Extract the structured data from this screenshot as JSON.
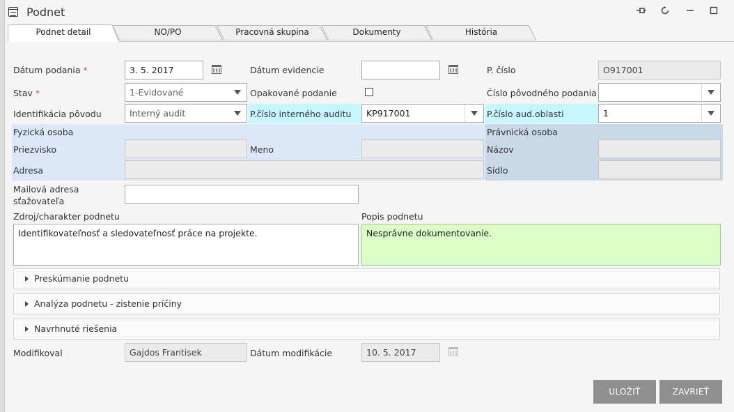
{
  "window": {
    "title": "Podnet"
  },
  "tabs": [
    "Podnet detail",
    "NO/PO",
    "Pracovná skupina",
    "Dokumenty",
    "História"
  ],
  "form": {
    "datum_podania": {
      "label": "Dátum podania",
      "required": "*",
      "value": "3. 5. 2017"
    },
    "datum_evidencie": {
      "label": "Dátum evidencie",
      "value": ""
    },
    "p_cislo": {
      "label": "P. číslo",
      "value": "O917001"
    },
    "stav": {
      "label": "Stav",
      "required": "*",
      "value": "1-Evidované"
    },
    "opakovane_podanie": {
      "label": "Opakované podanie",
      "checked": false
    },
    "cislo_povodneho": {
      "label": "Číslo pôvodného podania",
      "value": ""
    },
    "identifikacia_povodu": {
      "label": "Identifikácia pôvodu",
      "value": "Interný audit"
    },
    "p_cislo_auditu": {
      "label": "P.číslo interného auditu",
      "value": "KP917001"
    },
    "p_cislo_oblasti": {
      "label": "P.číslo aud.oblasti",
      "value": "1"
    },
    "fyzicka_osoba": {
      "label": "Fyzická osoba"
    },
    "priezvisko": {
      "label": "Priezvisko",
      "value": ""
    },
    "meno": {
      "label": "Meno",
      "value": ""
    },
    "adresa": {
      "label": "Adresa",
      "value": ""
    },
    "pravnicka_osoba": {
      "label": "Právnická osoba"
    },
    "nazov": {
      "label": "Názov",
      "value": ""
    },
    "sidlo": {
      "label": "Sídlo",
      "value": ""
    },
    "mailova_adresa": {
      "label_line1": "Mailová adresa",
      "label_line2": "sťažovateľa",
      "value": ""
    },
    "zdroj": {
      "label": "Zdroj/charakter podnetu",
      "value": "Identifikovateľnosť a sledovateľnosť práce na projekte."
    },
    "popis": {
      "label": "Popis podnetu",
      "value": "Nesprávne dokumentovanie."
    }
  },
  "sections": [
    "Preskúmanie podnetu",
    "Analýza podnetu - zistenie príčiny",
    "Navrhnuté riešenia"
  ],
  "footer": {
    "modifikoval": {
      "label": "Modifikoval",
      "value": "Gajdos Frantisek"
    },
    "datum_modifikacie": {
      "label": "Dátum modifikácie",
      "value": "10. 5. 2017"
    }
  },
  "buttons": {
    "save": "ULOŽIŤ",
    "close": "ZAVRIEŤ"
  },
  "colors": {
    "highlight": "#c8f6ff",
    "person_band": "#dce8f7",
    "company_band": "#c9d9e8",
    "green_field": "#dcffc8",
    "button": "#8f8f8f"
  }
}
